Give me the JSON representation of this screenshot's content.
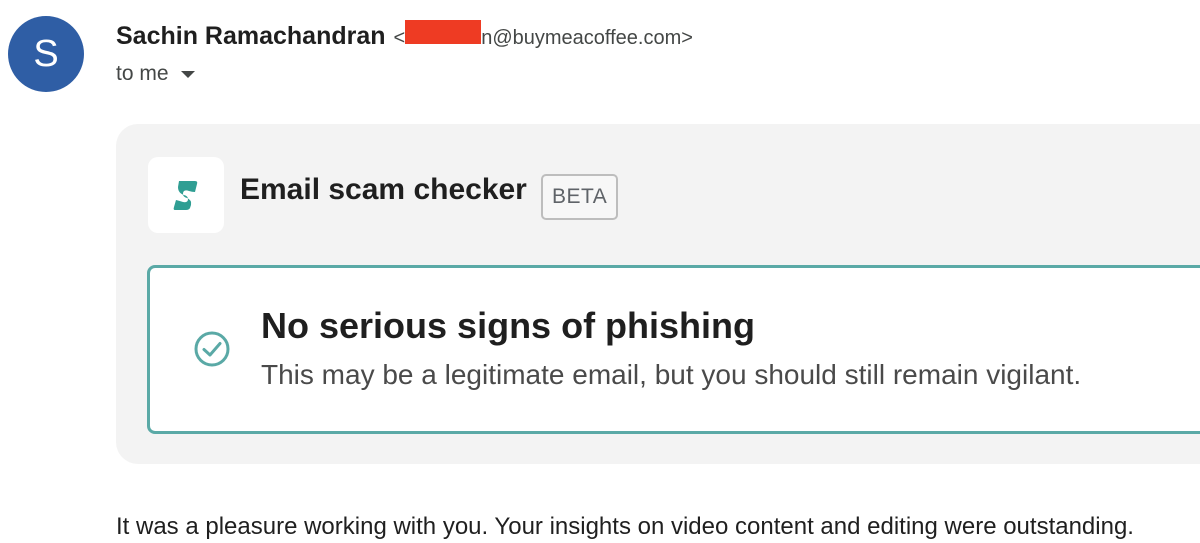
{
  "sender": {
    "avatar_letter": "S",
    "name": "Sachin Ramachandran",
    "email_open": "<",
    "email_domain": "n@buymeacoffee.com>"
  },
  "recipient": {
    "label": "to me"
  },
  "scam_checker": {
    "title": "Email scam checker",
    "badge": "BETA",
    "result_title": "No serious signs of phishing",
    "result_description": "This may be a legitimate email, but you should still remain vigilant."
  },
  "email_body": {
    "first_line": "It was a pleasure working with you. Your insights on video content and editing were outstanding. "
  },
  "colors": {
    "avatar": "#2f5ea5",
    "accent_teal": "#5aa9a6",
    "redaction": "#ee3b23",
    "card_background": "#f3f3f3"
  },
  "icons": {
    "logo": "surfshark-logo-icon",
    "check": "check-circle-icon",
    "caret": "caret-down-icon"
  }
}
